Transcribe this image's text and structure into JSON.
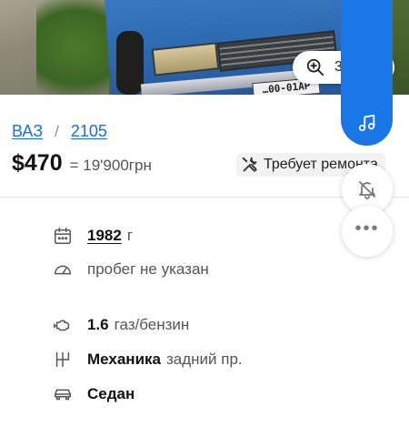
{
  "photo": {
    "plate_text": "…00-01AP",
    "zoom_count": "3"
  },
  "breadcrumb": {
    "brand": "ВАЗ",
    "separator": "/",
    "model": "2105"
  },
  "price": {
    "usd": "$470",
    "uah": "= 19'900грн"
  },
  "badge": {
    "repair_label": "Требует ремонта"
  },
  "specs": {
    "year_value": "1982",
    "year_unit": "г",
    "mileage_text": "пробег не указан",
    "engine_volume": "1.6",
    "fuel": "газ/бензин",
    "transmission": "Механика",
    "drive": "задний пр.",
    "body": "Седан"
  },
  "icons": {
    "zoom": "zoom-in-icon",
    "music": "music-note-icon",
    "repair": "wrench-screwdriver-icon",
    "bell": "bell-off-icon",
    "more": "more-dots-icon",
    "calendar": "calendar-icon",
    "speedometer": "speedometer-icon",
    "engine": "engine-icon",
    "gearbox": "gearbox-icon",
    "car": "car-body-icon"
  },
  "colors": {
    "accent_blue": "#1976e6",
    "link_blue": "#1a6fd8",
    "text_dark": "#111111",
    "text_gray": "#555555"
  }
}
